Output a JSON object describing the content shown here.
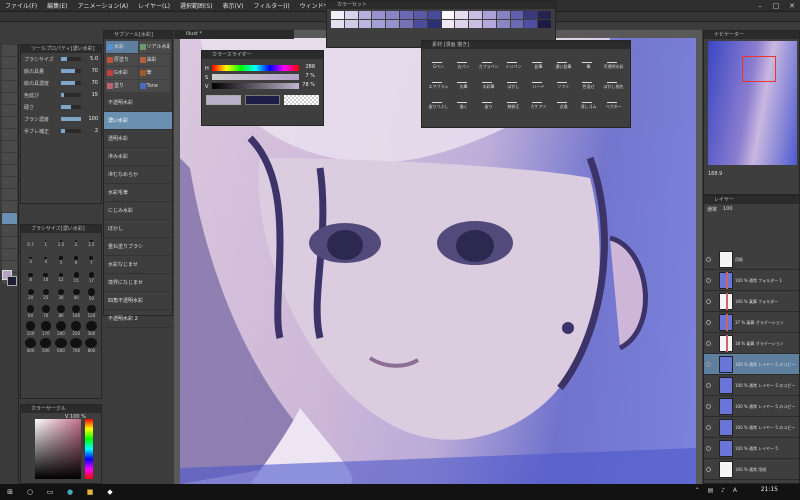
{
  "menu": {
    "items": [
      "ファイル(F)",
      "編集(E)",
      "アニメーション(A)",
      "レイヤー(L)",
      "選択範囲(S)",
      "表示(V)",
      "フィルター(I)",
      "ウィンドウ(W)",
      "ヘルプ(H)"
    ],
    "win_min": "–",
    "win_max": "□",
    "win_close": "✕"
  },
  "tool_property": {
    "title": "ツールプロパティ[濃い水彩]",
    "rows": [
      {
        "label": "ブラシサイズ",
        "value": "5.0",
        "level": 0.3
      },
      {
        "label": "絵の具量",
        "value": "70",
        "level": 0.7
      },
      {
        "label": "絵の具濃度",
        "value": "70",
        "level": 0.7
      },
      {
        "label": "色延び",
        "value": "15",
        "level": 0.15
      },
      {
        "label": "硬さ",
        "value": "",
        "level": 0.5
      },
      {
        "label": "ブラシ濃度",
        "value": "100",
        "level": 1.0
      },
      {
        "label": "手ブレ補正",
        "value": "2",
        "level": 0.2
      }
    ]
  },
  "brush_size": {
    "title": "ブラシサイズ[濃い水彩]",
    "sizes": [
      "0.7",
      "1",
      "1.5",
      "2",
      "2.5",
      "3",
      "4",
      "5",
      "6",
      "7",
      "8",
      "10",
      "12",
      "15",
      "17",
      "20",
      "25",
      "30",
      "40",
      "50",
      "60",
      "70",
      "80",
      "100",
      "120",
      "150",
      "170",
      "200",
      "250",
      "300",
      "400",
      "500",
      "600",
      "700",
      "800"
    ]
  },
  "color_circle": {
    "title": "カラーサークル",
    "v_value": "V 100 %"
  },
  "subtool": {
    "title": "サブツール[水彩]",
    "tabs": [
      {
        "label": "水彩",
        "color": "#5a8fd0",
        "on": true
      },
      {
        "label": "リアル水彩",
        "color": "#6a9a6a",
        "on": false
      },
      {
        "label": "厚塗り",
        "color": "#c0503a",
        "on": false
      },
      {
        "label": "油彩",
        "color": "#b0603a",
        "on": false
      },
      {
        "label": "G水彩",
        "color": "#c04040",
        "on": false
      },
      {
        "label": "筆",
        "color": "#a05a2a",
        "on": false
      },
      {
        "label": "塗り",
        "color": "#c06070",
        "on": false
      },
      {
        "label": "Tone",
        "color": "#4a6ac0",
        "on": false
      }
    ],
    "items": [
      {
        "label": "不透明水彩",
        "on": false
      },
      {
        "label": "濃い水彩",
        "on": true
      },
      {
        "label": "透明水彩",
        "on": false
      },
      {
        "label": "滲み水彩",
        "on": false
      },
      {
        "label": "滲むなめらか",
        "on": false
      },
      {
        "label": "水彩毛筆",
        "on": false
      },
      {
        "label": "にじみ水彩",
        "on": false
      },
      {
        "label": "ぼかし",
        "on": false
      },
      {
        "label": "重ね塗りブラシ",
        "on": false
      },
      {
        "label": "水彩なじませ",
        "on": false
      },
      {
        "label": "境界になじませ",
        "on": false
      },
      {
        "label": "四角不透明水彩",
        "on": false
      },
      {
        "label": "不透明水彩 2",
        "on": false
      }
    ]
  },
  "canvas": {
    "tab_label": "illust *"
  },
  "color_set": {
    "title": "カラーセット",
    "colors": [
      "#f0eef7",
      "#d8d2ec",
      "#b7b0de",
      "#9a90cf",
      "#8a85c7",
      "#6b68b5",
      "#5a5aa8",
      "#484a9a",
      "#fbf9fb",
      "#e6dcef",
      "#c5bde2",
      "#aaa2d6",
      "#8783c3",
      "#5f60ad",
      "#39397c",
      "#24234f",
      "#e3e0ef",
      "#cfcae6",
      "#bcb7df",
      "#a59fd5",
      "#9591ca",
      "#7771ba",
      "#4a4d9d",
      "#2e2e73",
      "#efe9f5",
      "#ddd3ec",
      "#cabfe3",
      "#b5a9d9",
      "#8d86c4",
      "#6d6ab4",
      "#4e4ea2",
      "#1b1b44"
    ]
  },
  "color_slider": {
    "title": "カラースライダー",
    "rows": [
      {
        "name": "H",
        "value": "288"
      },
      {
        "name": "S",
        "value": "7 %"
      },
      {
        "name": "V",
        "value": "78 %"
      }
    ],
    "current": "#b8b0c9",
    "secondary": "#1d1d48"
  },
  "material": {
    "title": "素材 [漫画 描き]",
    "items": [
      "Gペン",
      "丸ペン",
      "カブラペン",
      "ミリペン",
      "鉛筆",
      "濃い鉛筆",
      "筆",
      "不透明水彩",
      "エアブラシ",
      "丸筆",
      "水彩筆",
      "ぼかし",
      "ハード",
      "ソフト",
      "色混ぜ",
      "ぼかし指先",
      "塗りつぶし",
      "描く",
      "塗り",
      "線修正",
      "カケアミ",
      "点描",
      "消しゴム",
      "ベクター"
    ]
  },
  "navigator": {
    "title": "ナビゲーター",
    "zoom": "188.9"
  },
  "layers": {
    "title": "レイヤー",
    "blend": "通常",
    "opacity": "100",
    "rows": [
      {
        "name": "用紙",
        "thumb": "w",
        "on": false,
        "clip": false
      },
      {
        "name": "100 % 通常 フォルダー 1",
        "thumb": "b",
        "on": false,
        "clip": true
      },
      {
        "name": "100 % 乗算 フォルダー",
        "thumb": "w",
        "on": false,
        "clip": true
      },
      {
        "name": "37 % 乗算 グラデーション",
        "thumb": "b",
        "on": false,
        "clip": true
      },
      {
        "name": "18 % 乗算 グラデーション",
        "thumb": "w",
        "on": false,
        "clip": true
      },
      {
        "name": "100 % 通常 レイヤー 5 のコピー 6",
        "thumb": "b",
        "on": true,
        "clip": false
      },
      {
        "name": "100 % 通常 レイヤー 5 のコピー 4",
        "thumb": "b",
        "on": false,
        "clip": false
      },
      {
        "name": "100 % 通常 レイヤー 5 のコピー 3",
        "thumb": "b",
        "on": false,
        "clip": false
      },
      {
        "name": "100 % 通常 レイヤー 5 のコピー 2",
        "thumb": "b",
        "on": false,
        "clip": false
      },
      {
        "name": "100 % 通常 レイヤー 5",
        "thumb": "b",
        "on": false,
        "clip": false
      },
      {
        "name": "100 % 通常 用紙",
        "thumb": "w",
        "on": false,
        "clip": false
      }
    ]
  },
  "taskbar": {
    "clock": "21:15",
    "ime": "A"
  }
}
